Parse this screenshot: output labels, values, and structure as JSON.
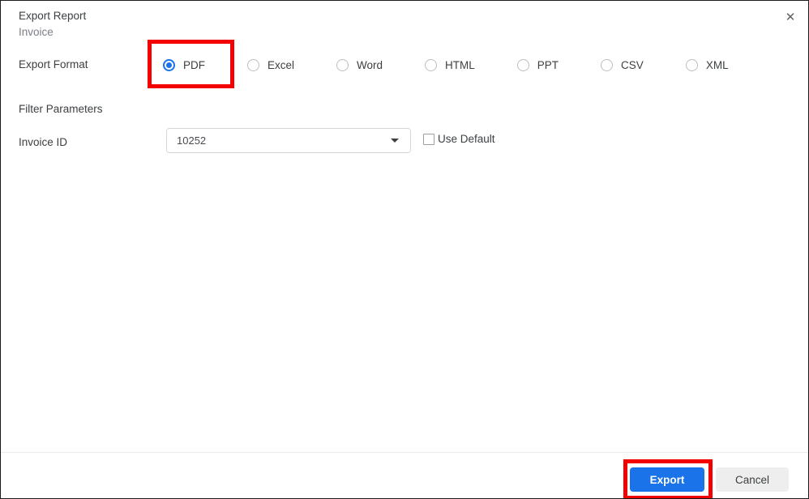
{
  "dialog": {
    "title": "Export Report",
    "subtitle": "Invoice",
    "close_icon": "close-icon",
    "close_glyph": "✕"
  },
  "export_format": {
    "label": "Export Format",
    "selected": "PDF",
    "options": [
      {
        "label": "PDF",
        "selected": true
      },
      {
        "label": "Excel",
        "selected": false
      },
      {
        "label": "Word",
        "selected": false
      },
      {
        "label": "HTML",
        "selected": false
      },
      {
        "label": "PPT",
        "selected": false
      },
      {
        "label": "CSV",
        "selected": false
      },
      {
        "label": "XML",
        "selected": false
      }
    ]
  },
  "filter_parameters": {
    "heading": "Filter Parameters",
    "invoice_id": {
      "label": "Invoice ID",
      "value": "10252",
      "caret_icon": "chevron-down-icon"
    },
    "use_default": {
      "label": "Use Default",
      "checked": false
    }
  },
  "footer": {
    "export_label": "Export",
    "cancel_label": "Cancel"
  },
  "colors": {
    "accent_blue": "#1a73e8",
    "highlight_red": "#f40000",
    "cancel_gray": "#eeeeee",
    "text": "#3c4043",
    "muted_text": "#7a7f85",
    "border": "#d4d7da"
  }
}
